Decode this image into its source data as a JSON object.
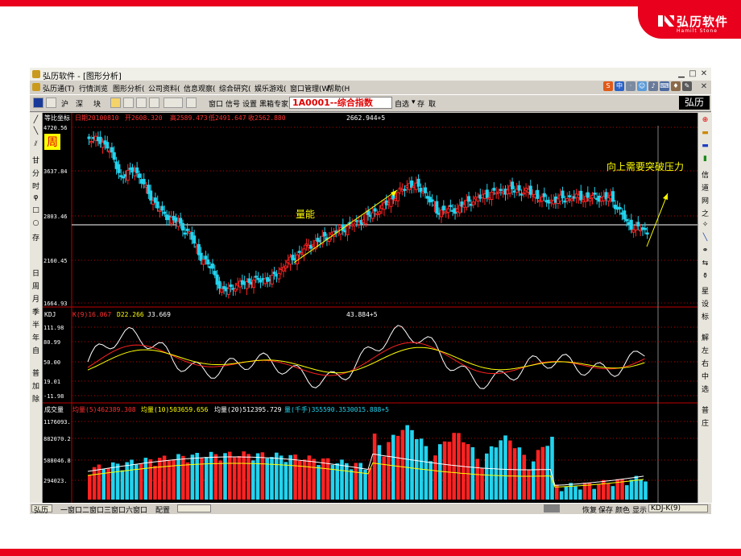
{
  "slide": {
    "brand_logo_text": "弘历软件",
    "brand_logo_sub": "Hamilt Stone"
  },
  "window": {
    "title": "弘历软件 - [图形分析]",
    "menu": [
      "弘历通(T)",
      "行情浏览",
      "图形分析(",
      "公司资料(",
      "信息观察(",
      "综合研究(",
      "娱乐游戏(",
      "窗口管理(W",
      "帮助(H"
    ],
    "toolbar": {
      "buttons_left": [
        "沪",
        "深",
        "块"
      ],
      "buttons_mid": [
        "窗口",
        "信号",
        "设置",
        "黑箱专家"
      ],
      "stock_field": "1A0001--综合指数",
      "buttons_right": [
        "自选",
        "存",
        "取"
      ],
      "brand": "弘历"
    },
    "left_toolbar": [
      "甘",
      "分",
      "时",
      "存",
      "日",
      "周",
      "月",
      "季",
      "半",
      "年",
      "自",
      "普",
      "加",
      "除"
    ],
    "right_toolbar": [
      "信",
      "道",
      "网",
      "之",
      "星",
      "设",
      "标",
      "解",
      "左",
      "右",
      "中",
      "选",
      "普",
      "庄"
    ],
    "status": {
      "tab": "弘历",
      "windows": [
        "一窗口",
        "二窗口",
        "三窗口",
        "六窗口"
      ],
      "config": "配置",
      "right_buttons": [
        "恢复",
        "保存",
        "颜色",
        "显示"
      ],
      "indicator": "KDJ-K(9)"
    }
  },
  "main_panel": {
    "title": "等比坐标",
    "date_label": "日期20100810",
    "open_label": "开2608.320",
    "high_label": "高2589.473",
    "low_label": "低2491.647",
    "close_label": "收2562.880",
    "top_value": "2662.944+5",
    "period_badge": "周",
    "y_ticks": [
      "4720.56",
      "3637.84",
      "2803.46",
      "2160.45",
      "1664.93"
    ],
    "annotation_volume": "量能",
    "annotation_pressure": "向上需要突破压力"
  },
  "kdj_panel": {
    "title": "KDJ",
    "k_label": "K(9)16.067",
    "d_label": "D22.266",
    "j_label": "J3.669",
    "top_value": "43.884+5",
    "y_ticks": [
      "111.98",
      "80.99",
      "50.00",
      "19.01",
      "-11.98"
    ]
  },
  "volume_panel": {
    "title": "成交量",
    "ma5_label": "均量(5)462389.308",
    "ma10_label": "均量(10)503659.656",
    "ma20_label": "均量(20)512395.729",
    "vol_label": "量(千手)355590.3530015.888+5",
    "y_ticks": [
      "1176093.",
      "882070.2",
      "588046.8",
      "294023."
    ]
  },
  "colors": {
    "up": "#ff2222",
    "down": "#22d3ee",
    "k_line": "#ffffff",
    "d_line": "#ffff00",
    "j_line": "#ff2020",
    "grid": "#c00000",
    "brand_red": "#e8001c"
  }
}
